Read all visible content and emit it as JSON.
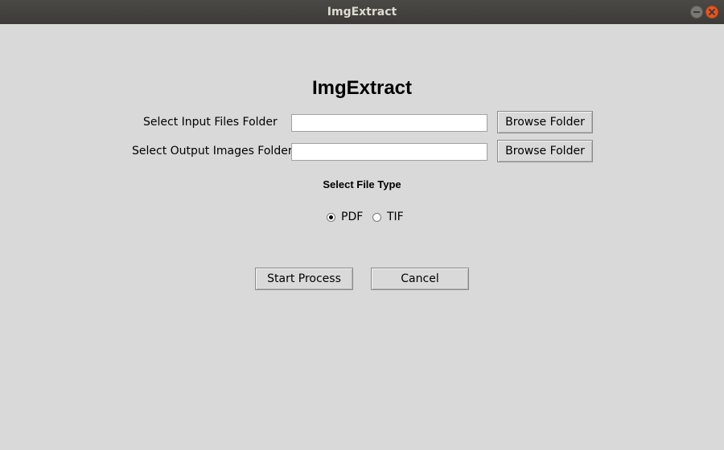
{
  "window": {
    "title": "ImgExtract"
  },
  "header": {
    "title": "ImgExtract"
  },
  "input_folder": {
    "label": "Select Input Files Folder",
    "value": "",
    "browse_label": "Browse Folder"
  },
  "output_folder": {
    "label": "Select Output Images Folder",
    "value": "",
    "browse_label": "Browse Folder"
  },
  "file_type": {
    "label": "Select File Type",
    "options": [
      {
        "label": "PDF",
        "selected": true
      },
      {
        "label": "TIF",
        "selected": false
      }
    ]
  },
  "actions": {
    "start_label": "Start Process",
    "cancel_label": "Cancel"
  },
  "icons": {
    "minimize": "minimize-icon",
    "close": "close-icon"
  },
  "colors": {
    "titlebar": "#3c3b37",
    "close_button": "#e95420",
    "background": "#d9d9d9"
  }
}
